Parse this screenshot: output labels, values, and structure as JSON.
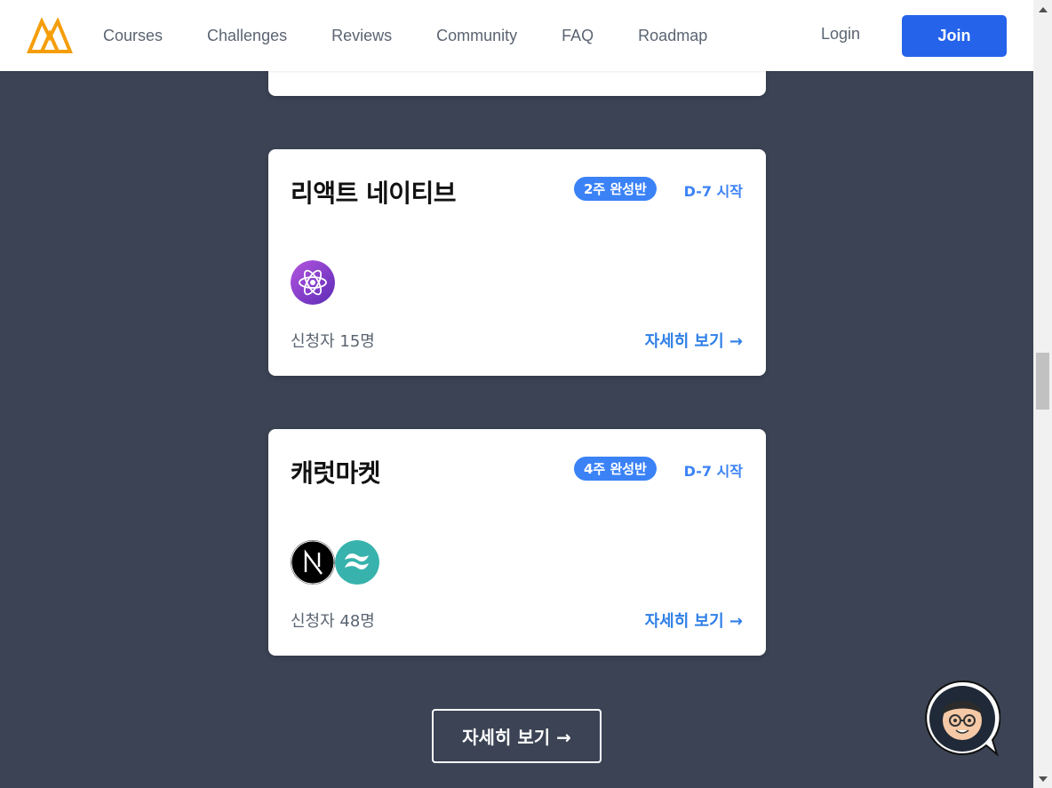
{
  "header": {
    "nav": [
      "Courses",
      "Challenges",
      "Reviews",
      "Community",
      "FAQ",
      "Roadmap"
    ],
    "login_label": "Login",
    "join_label": "Join"
  },
  "colors": {
    "brand_orange": "#f59e0b",
    "primary_blue": "#2563eb",
    "badge_blue": "#3b82f6",
    "page_bg": "#3b4354"
  },
  "cards": [
    {
      "title": "리액트 네이티브",
      "badge": "2주 완성반",
      "dday": "D-7 시작",
      "applicants": "신청자 15명",
      "detail_label": "자세히 보기 →",
      "tech_icons": [
        "react-icon"
      ]
    },
    {
      "title": "캐럿마켓",
      "badge": "4주 완성반",
      "dday": "D-7 시작",
      "applicants": "신청자 48명",
      "detail_label": "자세히 보기 →",
      "tech_icons": [
        "nextjs-icon",
        "tailwind-icon"
      ]
    }
  ],
  "more_button_label": "자세히 보기 →"
}
